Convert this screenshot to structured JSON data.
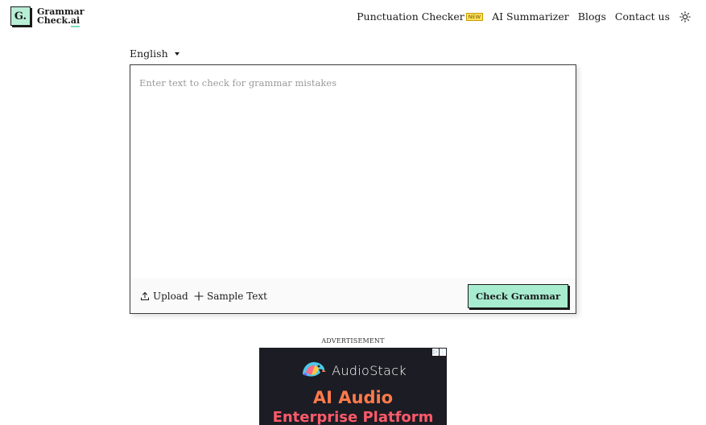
{
  "header": {
    "logo": {
      "mark": "G.",
      "line1": "Grammar",
      "line2_main": "Check.",
      "line2_accent": "ai"
    },
    "nav": [
      {
        "label": "Punctuation Checker",
        "badge": "NEW"
      },
      {
        "label": "AI Summarizer"
      },
      {
        "label": "Blogs"
      },
      {
        "label": "Contact us"
      }
    ],
    "theme_icon": "sun-icon"
  },
  "language": {
    "selected": "English"
  },
  "editor": {
    "placeholder": "Enter text to check for grammar mistakes",
    "value": "",
    "upload_label": "Upload",
    "sample_label": "Sample Text",
    "check_label": "Check Grammar"
  },
  "ad": {
    "label": "ADVERTISEMENT",
    "brand": "AudioStack",
    "headline1": "AI Audio",
    "headline2": "Enterprise Platform"
  },
  "colors": {
    "accent": "#a8ecd0",
    "badge": "#ffe45c",
    "ad_bg": "#1c1c24"
  }
}
